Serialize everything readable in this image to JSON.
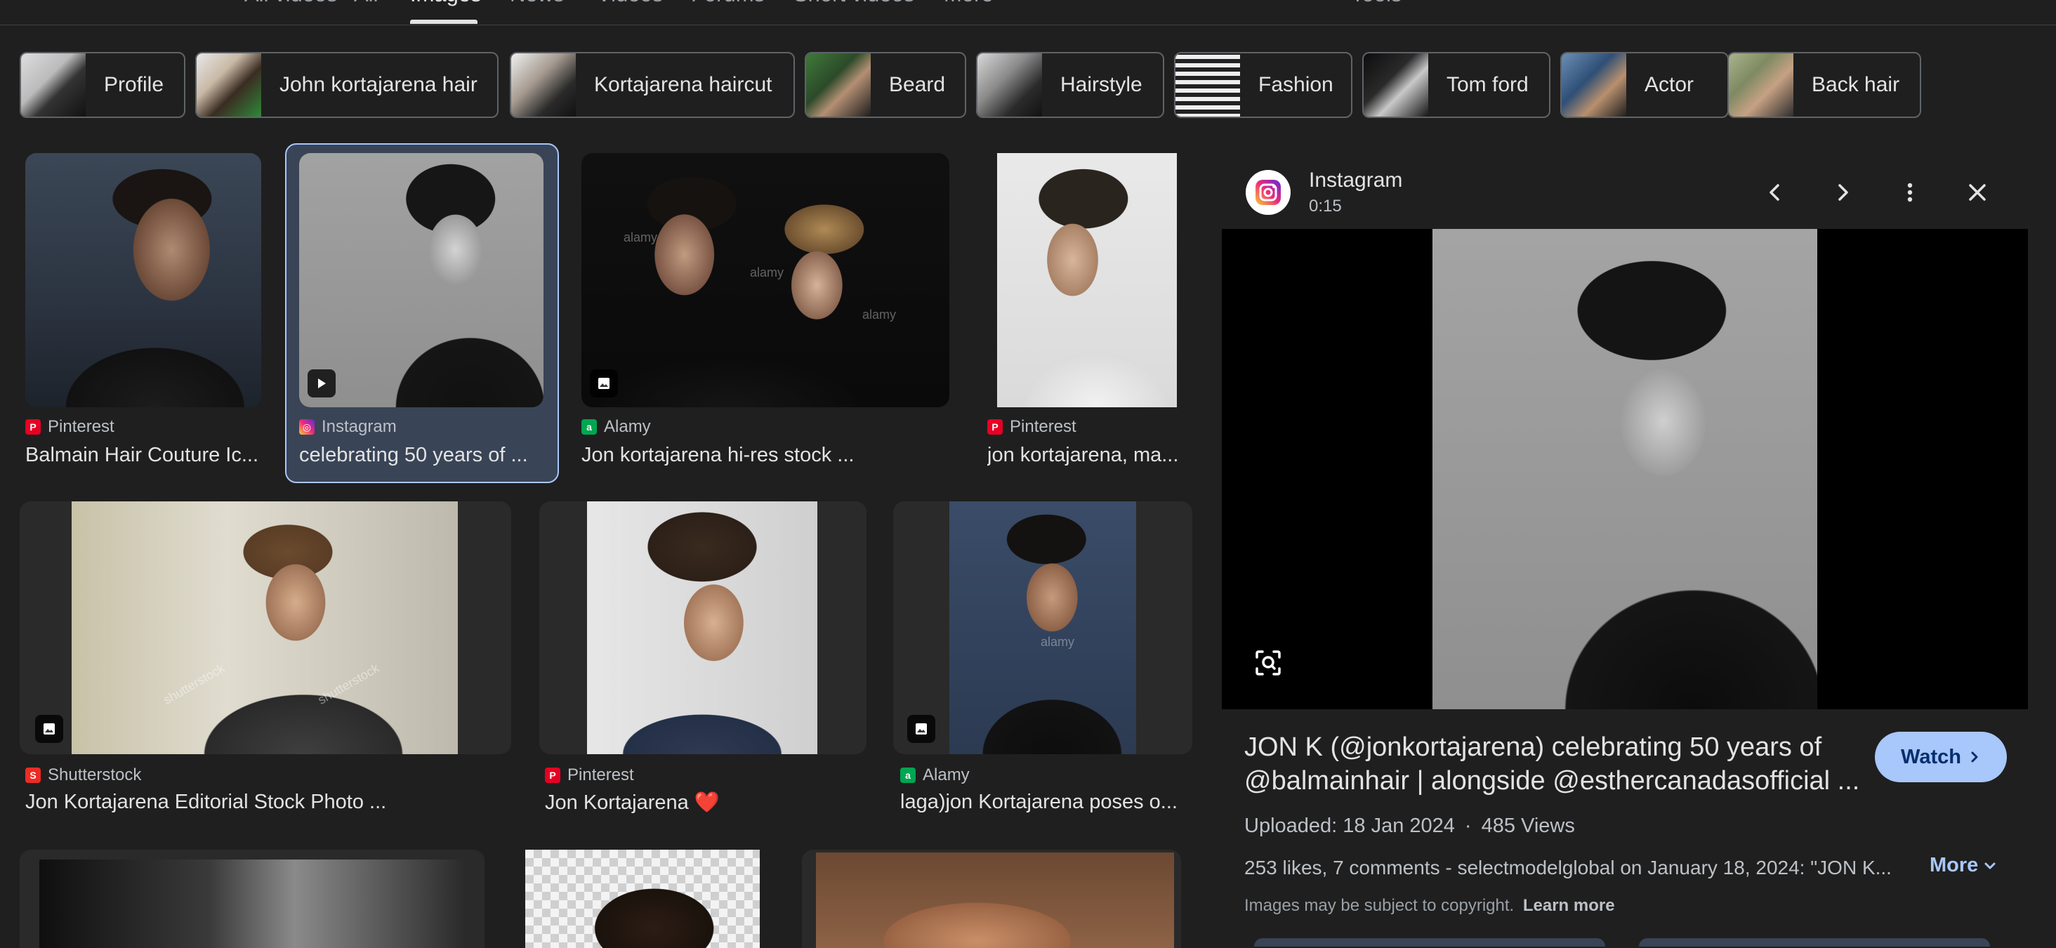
{
  "nav": {
    "tabs": [
      {
        "label": "All videos"
      },
      {
        "label": "All"
      },
      {
        "label": "Images"
      },
      {
        "label": "News"
      },
      {
        "label": "Videos"
      },
      {
        "label": "Forums"
      },
      {
        "label": "Short videos"
      },
      {
        "label": "More"
      }
    ],
    "tools": "Tools"
  },
  "chips": [
    {
      "label": "Profile"
    },
    {
      "label": "John kortajarena hair"
    },
    {
      "label": "Kortajarena haircut"
    },
    {
      "label": "Beard"
    },
    {
      "label": "Hairstyle"
    },
    {
      "label": "Fashion"
    },
    {
      "label": "Tom ford"
    },
    {
      "label": "Actor"
    },
    {
      "label": "Back hair"
    }
  ],
  "results": [
    {
      "source": "Pinterest",
      "title": "Balmain Hair Couture Ic..."
    },
    {
      "source": "Instagram",
      "title": "celebrating 50 years of ..."
    },
    {
      "source": "Alamy",
      "title": "Jon kortajarena hi-res stock ..."
    },
    {
      "source": "Pinterest",
      "title": "jon kortajarena, ma..."
    },
    {
      "source": "Shutterstock",
      "title": "Jon Kortajarena Editorial Stock Photo ..."
    },
    {
      "source": "Pinterest",
      "title": "Jon Kortajarena ❤️"
    },
    {
      "source": "Alamy",
      "title": "laga)jon Kortajarena poses o..."
    }
  ],
  "watermarks": {
    "alamy": "alamy",
    "shutterstock": "shutterstock"
  },
  "panel": {
    "source": "Instagram",
    "duration": "0:15",
    "title_line1": "JON K (@jonkortajarena) celebrating 50 years of",
    "title_line2": "@balmainhair | alongside @esthercanadasofficial ...",
    "watch_label": "Watch",
    "uploaded": "Uploaded: 18 Jan 2024",
    "views": "485 Views",
    "separator": "·",
    "description": "253 likes, 7 comments - selectmodelglobal on January 18, 2024: \"JON K...",
    "more_label": "More",
    "copyright": "Images may be subject to copyright.",
    "learn_more": "Learn more"
  },
  "colors": {
    "background": "#1f1f1f",
    "accent": "#a8c7fa",
    "selected_card": "#394457",
    "pinterest": "#e60023",
    "alamy": "#00a651",
    "shutterstock": "#ee2b24"
  },
  "icons": {
    "prev": "chevron-left-icon",
    "next": "chevron-right-icon",
    "menu": "more-vert-icon",
    "close": "close-icon",
    "lens": "lens-search-icon",
    "play": "play-icon",
    "image": "image-icon"
  }
}
